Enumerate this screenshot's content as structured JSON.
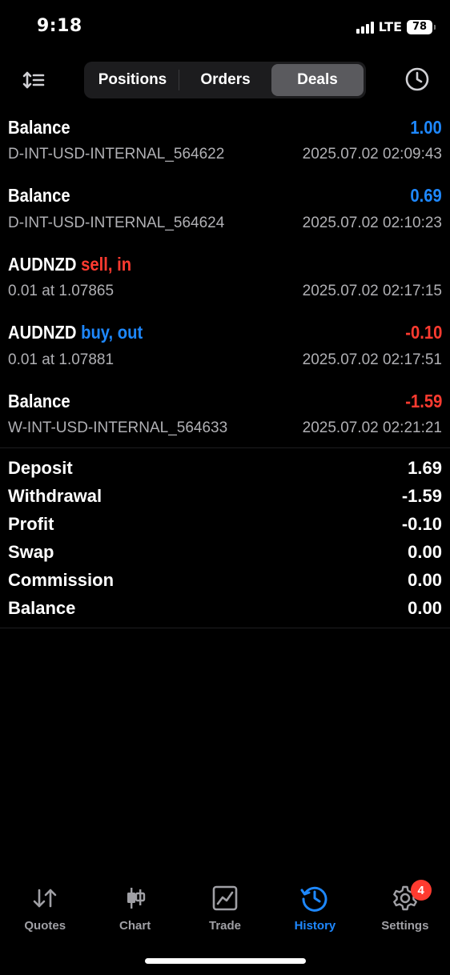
{
  "status_bar": {
    "time": "9:18",
    "network": "LTE",
    "battery": "78"
  },
  "toolbar": {
    "tabs": [
      {
        "label": "Positions",
        "active": false
      },
      {
        "label": "Orders",
        "active": false
      },
      {
        "label": "Deals",
        "active": true
      }
    ]
  },
  "deals": [
    {
      "title": "Balance",
      "side": "",
      "amount": "1.00",
      "amount_color": "blue",
      "sub": "D-INT-USD-INTERNAL_564622",
      "time": "2025.07.02 02:09:43"
    },
    {
      "title": "Balance",
      "side": "",
      "amount": "0.69",
      "amount_color": "blue",
      "sub": "D-INT-USD-INTERNAL_564624",
      "time": "2025.07.02 02:10:23"
    },
    {
      "title": "AUDNZD",
      "side": "sell, in",
      "side_color": "red",
      "amount": "",
      "sub": "0.01 at 1.07865",
      "time": "2025.07.02 02:17:15"
    },
    {
      "title": "AUDNZD",
      "side": "buy, out",
      "side_color": "blue",
      "amount": "-0.10",
      "amount_color": "red",
      "sub": "0.01 at 1.07881",
      "time": "2025.07.02 02:17:51"
    },
    {
      "title": "Balance",
      "side": "",
      "amount": "-1.59",
      "amount_color": "red",
      "sub": "W-INT-USD-INTERNAL_564633",
      "time": "2025.07.02 02:21:21"
    }
  ],
  "summary": [
    {
      "label": "Deposit",
      "value": "1.69"
    },
    {
      "label": "Withdrawal",
      "value": "-1.59"
    },
    {
      "label": "Profit",
      "value": "-0.10"
    },
    {
      "label": "Swap",
      "value": "0.00"
    },
    {
      "label": "Commission",
      "value": "0.00"
    },
    {
      "label": "Balance",
      "value": "0.00"
    }
  ],
  "tabbar": {
    "items": [
      {
        "label": "Quotes",
        "icon": "quotes-arrows-icon"
      },
      {
        "label": "Chart",
        "icon": "candlestick-icon"
      },
      {
        "label": "Trade",
        "icon": "trade-chart-icon"
      },
      {
        "label": "History",
        "icon": "history-clock-icon",
        "active": true
      },
      {
        "label": "Settings",
        "icon": "gear-icon",
        "badge": "4"
      }
    ]
  },
  "colors": {
    "blue": "#1e88ff",
    "red": "#ff3b30",
    "background": "#000000"
  }
}
